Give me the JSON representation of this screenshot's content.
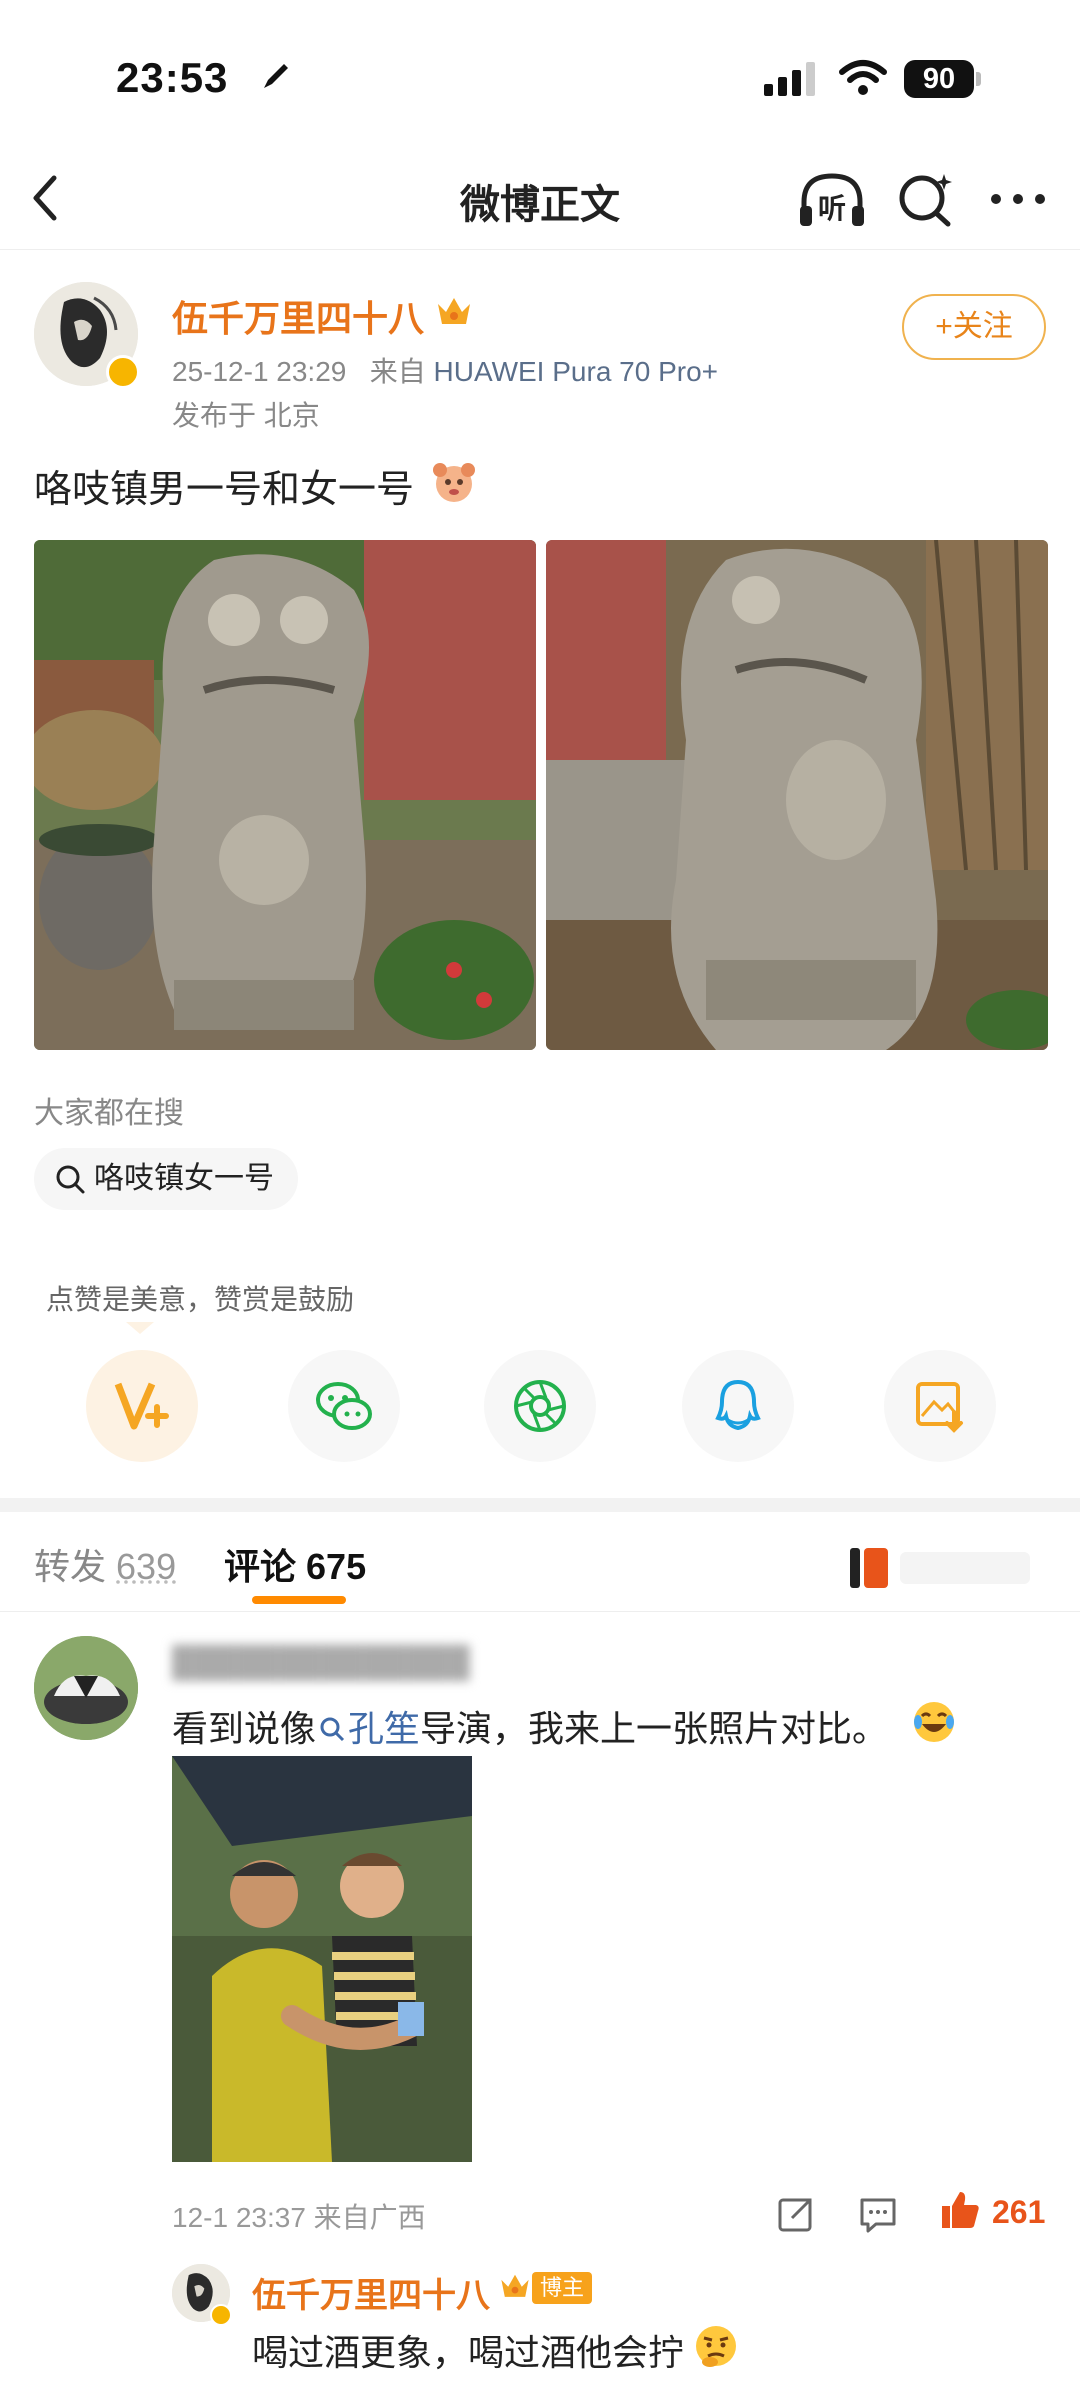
{
  "status_bar": {
    "time": "23:53",
    "battery": "90"
  },
  "nav": {
    "title": "微博正文",
    "listen_label": "听"
  },
  "post": {
    "author": "伍千万里四十八",
    "time": "25-12-1 23:29",
    "source_prefix": "来自",
    "device": "HUAWEI Pura 70 Pro+",
    "location": "发布于 北京",
    "follow_label": "+关注",
    "text": "咯吱镇男一号和女一号"
  },
  "trending": {
    "label": "大家都在搜",
    "chip": "咯吱镇女一号"
  },
  "reward": {
    "label": "点赞是美意，赞赏是鼓励"
  },
  "tabs": {
    "repost_label": "转发",
    "repost_count": "639",
    "comment_label": "评论",
    "comment_count": "675"
  },
  "comment": {
    "text_before": "看到说像",
    "link": "孔笙",
    "text_after": "导演，我来上一张照片对比。",
    "meta": "12-1 23:37 来自广西",
    "likes": "261"
  },
  "reply": {
    "author": "伍千万里四十八",
    "tag": "博主",
    "text": "喝过酒更象，喝过酒他会拧"
  },
  "colors": {
    "accent": "#ff8a00",
    "name": "#e8741a",
    "link": "#3f6aa8"
  }
}
